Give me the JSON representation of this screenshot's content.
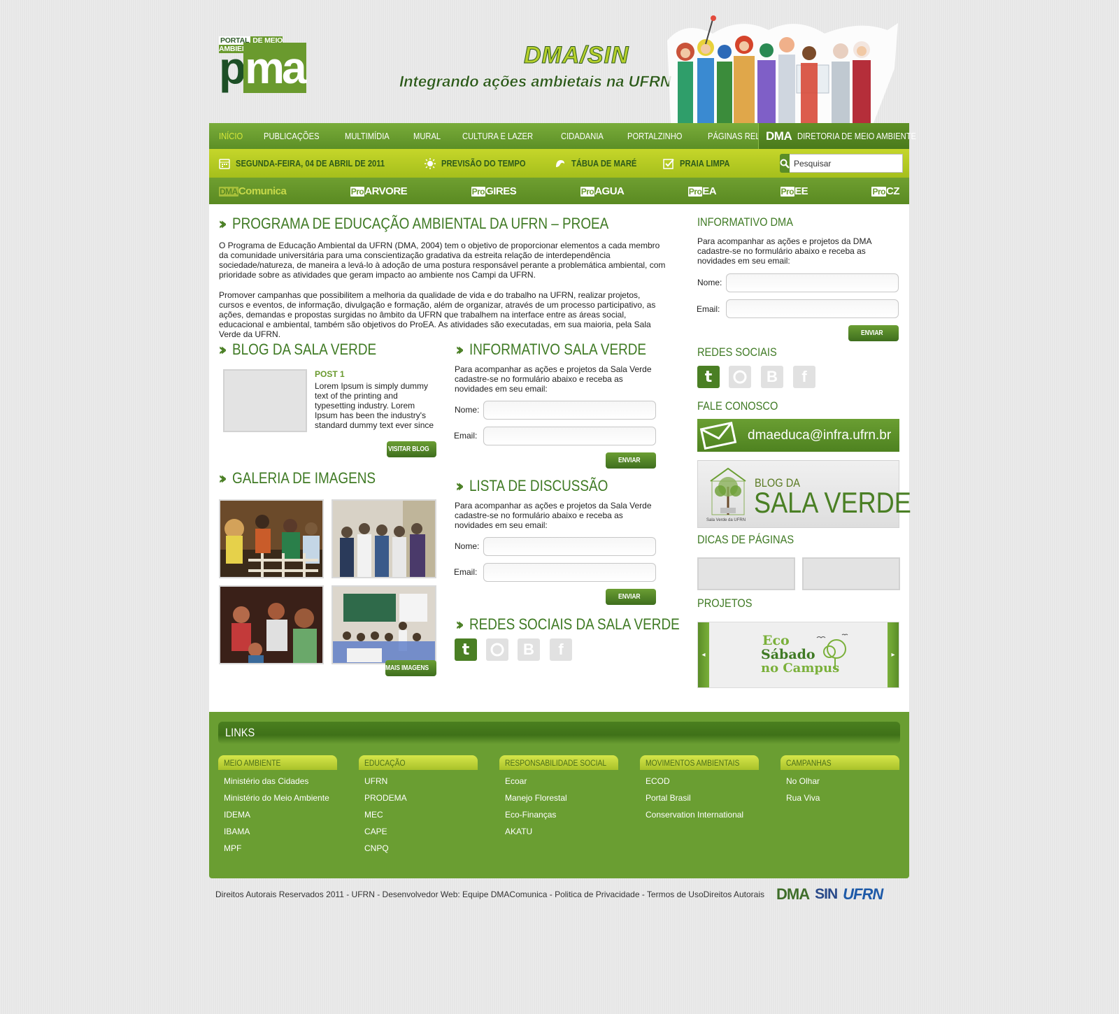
{
  "header": {
    "logo_top_left": "PORTAL",
    "logo_top_right": "DE MEIO AMBIENTE",
    "logo_p": "p",
    "logo_ma": "ma",
    "dma_sin": "DMA/SIN",
    "slogan": "Integrando ações ambietais na UFRN"
  },
  "nav_main": {
    "items": [
      "INÍCIO",
      "PUBLICAÇÕES",
      "MULTIMÍDIA",
      "MURAL",
      "CULTURA E LAZER",
      "CIDADANIA",
      "PORTALZINHO",
      "PÁGINAS RELACIONADAS"
    ],
    "dma_abbr": "DMA",
    "dma_label": "DIRETORIA DE MEIO AMBIENTE"
  },
  "nav_info": {
    "date": "SEGUNDA-FEIRA, 04 DE ABRIL DE 2011",
    "weather": "PREVISÃO DO TEMPO",
    "tide": "TÁBUA DE MARÉ",
    "beach": "PRAIA LIMPA",
    "search_placeholder": "Pesquisar"
  },
  "nav_programs": [
    {
      "pre": "DMA",
      "name": "Comunica"
    },
    {
      "pre": "Pro",
      "name": "ARVORE"
    },
    {
      "pre": "Pro",
      "name": "GIRES"
    },
    {
      "pre": "Pro",
      "name": "AGUA"
    },
    {
      "pre": "Pro",
      "name": "EA"
    },
    {
      "pre": "Pro",
      "name": "EE"
    },
    {
      "pre": "Pro",
      "name": "CZ"
    }
  ],
  "main": {
    "title": "PROGRAMA DE EDUCAÇÃO AMBIENTAL DA UFRN – PROEA",
    "para1": "O Programa de Educação Ambiental da UFRN (DMA, 2004) tem o objetivo de proporcionar elementos a cada membro da comunidade universitária para uma conscientização gradativa da estreita relação de interdependência sociedade/natureza, de maneira a levá-lo à adoção de uma postura responsável perante a problemática ambiental, com prioridade sobre as atividades que geram impacto ao ambiente nos Campi da UFRN.",
    "para2": "Promover campanhas que possibilitem a melhoria da qualidade de vida e do trabalho na UFRN, realizar projetos, cursos e eventos, de informação, divulgação e formação, além de organizar, através de um processo participativo, as ações, demandas e propostas surgidas no âmbito da UFRN que trabalhem na interface entre as áreas social, educacional e ambiental, também são objetivos do ProEA. As atividades são executadas, em sua maioria, pela Sala Verde da UFRN.",
    "blog": {
      "title": "BLOG DA SALA VERDE",
      "post_title": "POST 1",
      "post_text": "Lorem Ipsum is simply dummy text of the printing and typesetting industry. Lorem Ipsum has been the industry's standard dummy text ever since",
      "button": "VISITAR BLOG"
    },
    "gallery": {
      "title": "GALERIA DE IMAGENS",
      "button": "MAIS IMAGENS"
    },
    "info_sv": {
      "title": "INFORMATIVO SALA VERDE",
      "text": "Para acompanhar as ações e projetos da Sala Verde cadastre-se no formulário abaixo e receba as novidades em seu email:",
      "name_label": "Nome:",
      "email_label": "Email:",
      "button": "ENVIAR"
    },
    "lista": {
      "title": "LISTA DE DISCUSSÃO",
      "text": "Para acompanhar as ações e projetos da Sala Verde cadastre-se no formulário abaixo e receba as novidades em seu email:",
      "name_label": "Nome:",
      "email_label": "Email:",
      "button": "ENVIAR"
    },
    "redes_sv": {
      "title": "REDES SOCIAIS DA SALA VERDE"
    }
  },
  "sidebar": {
    "info_title": "INFORMATIVO DMA",
    "info_text": "Para acompanhar as ações e projetos da DMA cadastre-se no formulário abaixo e receba as novidades em seu email:",
    "name_label": "Nome:",
    "email_label": "Email:",
    "button": "ENVIAR",
    "redes_title": "REDES SOCIAIS",
    "fale_title": "FALE CONOSCO",
    "email": "dmaeduca@infra.ufrn.br",
    "blog_small": "BLOG DA",
    "blog_big": "SALA VERDE",
    "blog_caption": "Sala Verde da UFRN",
    "dicas_title": "DICAS DE PÁGINAS",
    "projetos_title": "PROJETOS",
    "proj_line1": "Eco",
    "proj_line2": "Sábado",
    "proj_line3": "no Campus"
  },
  "footer": {
    "links_title": "LINKS",
    "columns": [
      {
        "title": "MEIO AMBIENTE",
        "links": [
          "Ministério das Cidades",
          "Ministério do Meio Ambiente",
          "IDEMA",
          "IBAMA",
          "MPF"
        ]
      },
      {
        "title": "EDUCAÇÃO",
        "links": [
          "UFRN",
          "PRODEMA",
          "MEC",
          "CAPE",
          "CNPQ"
        ]
      },
      {
        "title": "RESPONSABILIDADE SOCIAL",
        "links": [
          "Ecoar",
          "Manejo Florestal",
          "Eco-Finanças",
          "AKATU"
        ]
      },
      {
        "title": "MOVIMENTOS AMBIENTAIS",
        "links": [
          "ECOD",
          "Portal Brasil",
          "Conservation International"
        ]
      },
      {
        "title": "CAMPANHAS",
        "links": [
          "No Olhar",
          "Rua Viva"
        ]
      }
    ],
    "copyright": "Direitos Autorais Reservados 2011 - UFRN - Desenvolvedor Web: Equipe DMAComunica - Politica de Privacidade - Termos de UsoDireitos Autorais",
    "logo_dma": "DMA",
    "logo_sin": "SIN",
    "logo_ufrn": "UFRN"
  }
}
